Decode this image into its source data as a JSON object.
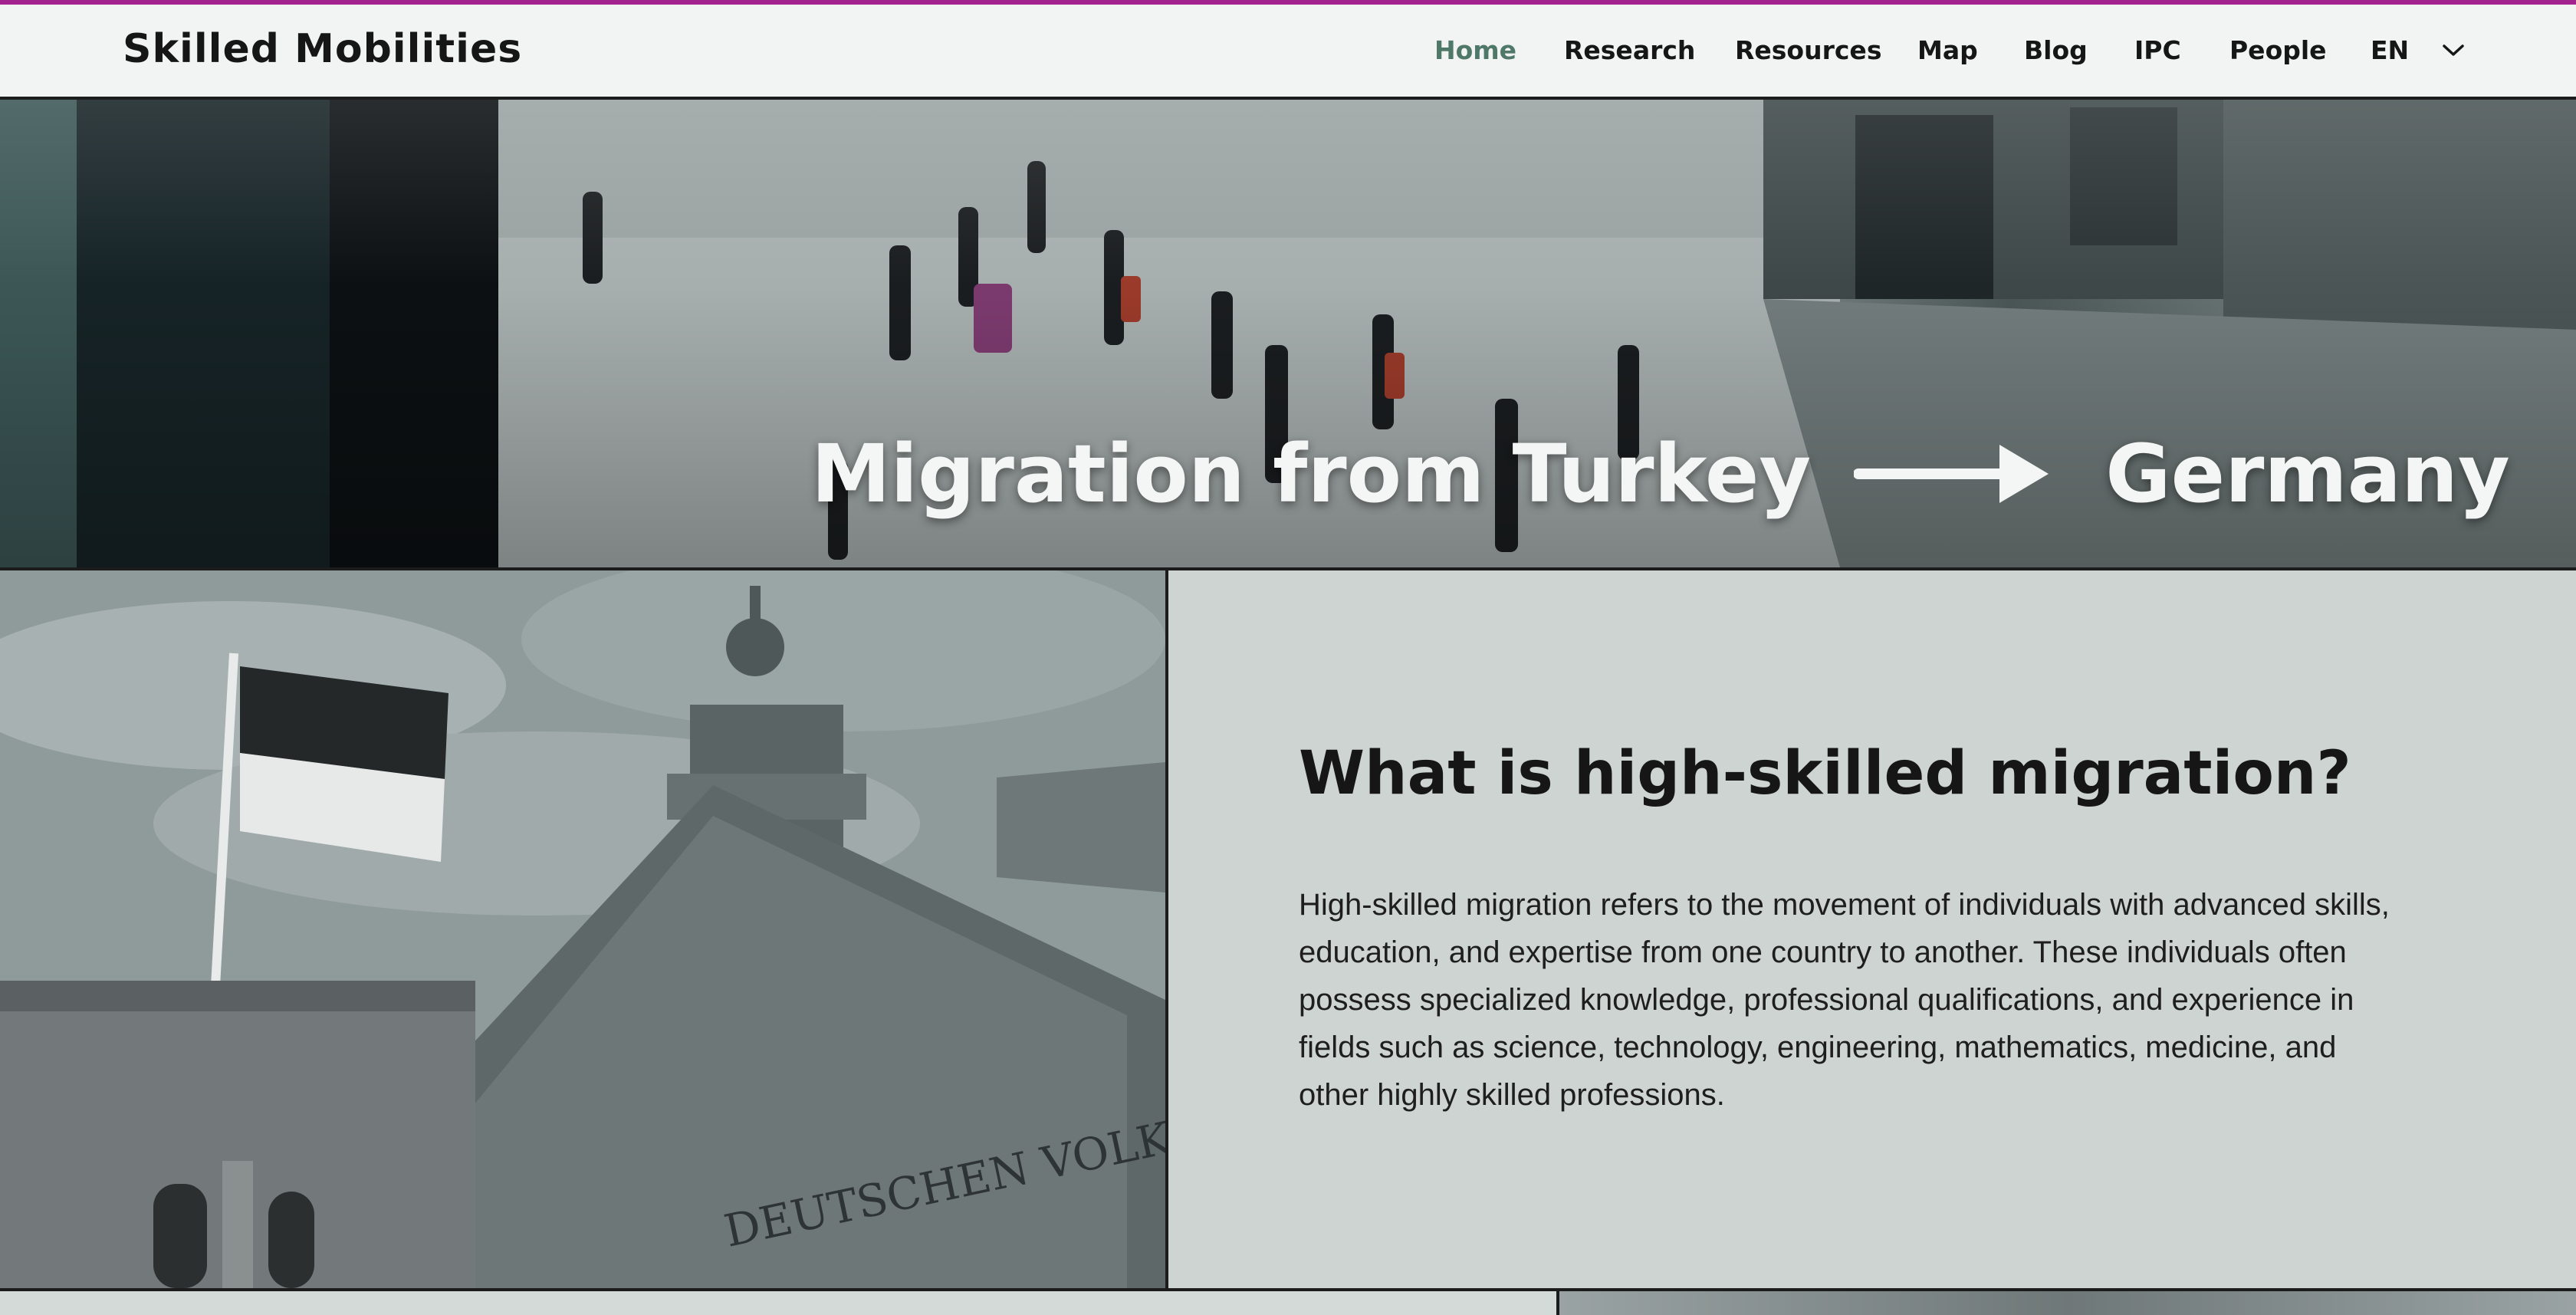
{
  "theme": {
    "accent_bar": "#a3238e",
    "active_nav": "#4f7869",
    "text_panel_bg": "#cdd4d1",
    "header_bg": "#f2f4f4"
  },
  "header": {
    "brand": "Skilled Mobilities",
    "nav": [
      {
        "label": "Home",
        "active": true
      },
      {
        "label": "Research",
        "active": false
      },
      {
        "label": "Resources",
        "active": false
      },
      {
        "label": "Map",
        "active": false
      },
      {
        "label": "Blog",
        "active": false
      },
      {
        "label": "IPC",
        "active": false
      },
      {
        "label": "People",
        "active": false
      }
    ],
    "language": {
      "selected": "EN",
      "icon": "chevron-down-icon"
    }
  },
  "hero": {
    "title_from": "Migration from Turkey",
    "arrow_icon": "arrow-right-icon",
    "title_to": "Germany"
  },
  "intro": {
    "heading": "What is high-skilled migration?",
    "body": "High-skilled migration refers to the movement of individuals with advanced skills, education, and expertise from one country to another. These individuals often possess specialized knowledge, professional qualifications, and experience in fields such as science, technology, engineering, mathematics, medicine, and other highly skilled professions."
  },
  "images": {
    "hero_photo": "airport-travelers-photo",
    "panel_photo": "reichstag-building-photo",
    "panel_photo_inscription": "DEUTSCHEN VOLKE"
  }
}
